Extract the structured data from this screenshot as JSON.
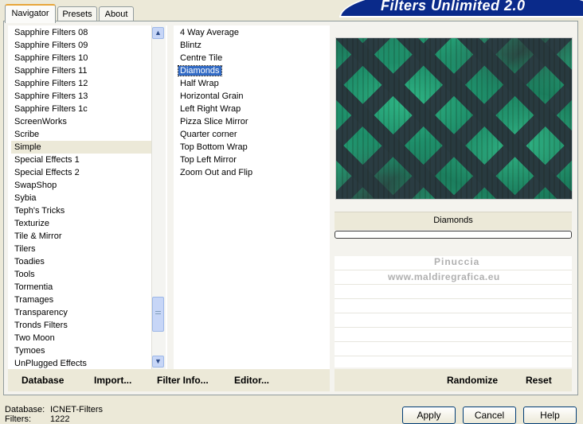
{
  "tabs": [
    "Navigator",
    "Presets",
    "About"
  ],
  "banner_title": "Filters Unlimited 2.0",
  "categories": [
    "Sapphire Filters 08",
    "Sapphire Filters 09",
    "Sapphire Filters 10",
    "Sapphire Filters 11",
    "Sapphire Filters 12",
    "Sapphire Filters 13",
    "Sapphire Filters 1c",
    "ScreenWorks",
    "Scribe",
    "Simple",
    "Special Effects 1",
    "Special Effects 2",
    "SwapShop",
    "Sybia",
    "Teph's Tricks",
    "Texturize",
    "Tile & Mirror",
    "Tilers",
    "Toadies",
    "Tools",
    "Tormentia",
    "Tramages",
    "Transparency",
    "Tronds Filters",
    "Two Moon",
    "Tymoes",
    "UnPlugged Effects"
  ],
  "highlighted_category": "Simple",
  "filters": [
    "4 Way Average",
    "Blintz",
    "Centre Tile",
    "Diamonds",
    "Half Wrap",
    "Horizontal Grain",
    "Left Right Wrap",
    "Pizza Slice Mirror",
    "Quarter corner",
    "Top Bottom Wrap",
    "Top Left Mirror",
    "Zoom Out and Flip"
  ],
  "selected_filter": "Diamonds",
  "preview_label": "Diamonds",
  "watermark": {
    "line1": "Pinuccia",
    "line2": "www.maldiregrafica.eu"
  },
  "toolbar": {
    "database": "Database",
    "import": "Import...",
    "filter_info": "Filter Info...",
    "editor": "Editor...",
    "randomize": "Randomize",
    "reset": "Reset"
  },
  "status": {
    "database_label": "Database:",
    "database_value": "ICNET-Filters",
    "filters_label": "Filters:",
    "filters_value": "1222"
  },
  "dialog": {
    "apply": "Apply",
    "cancel": "Cancel",
    "help": "Help"
  },
  "icons": {
    "scroll_up": "chevron-up-icon",
    "scroll_down": "chevron-down-icon",
    "thumb_grip": "grip-icon"
  }
}
